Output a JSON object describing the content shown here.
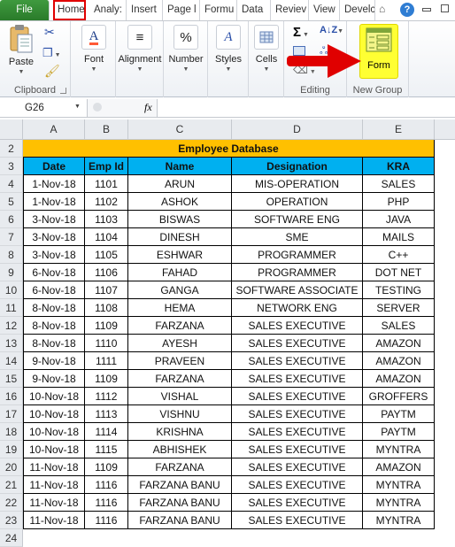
{
  "ribbon_tabs": [
    "File",
    "Home",
    "Analy:",
    "Insert",
    "Page l",
    "Formu",
    "Data",
    "Reviev",
    "View",
    "Develc"
  ],
  "active_tab": "Home",
  "window_controls": [
    "minimize-ribbon",
    "help",
    "minimize",
    "restore"
  ],
  "ribbon": {
    "clipboard": {
      "paste_label": "Paste",
      "group_label": "Clipboard"
    },
    "font_label": "Font",
    "alignment_label": "Alignment",
    "number_label": "Number",
    "number_icon": "%",
    "styles_label": "Styles",
    "cells_label": "Cells",
    "editing": {
      "group_label": "Editing",
      "sum_icon": "Σ"
    },
    "new_group": {
      "form_label": "Form",
      "group_label": "New Group"
    }
  },
  "formula_bar": {
    "name_box": "G26",
    "fx": "fx",
    "formula": ""
  },
  "columns": [
    "A",
    "B",
    "C",
    "D",
    "E"
  ],
  "sheet": {
    "title_row_number": "2",
    "title": "Employee Database",
    "header_row_number": "3",
    "headers": [
      "Date",
      "Emp Id",
      "Name",
      "Designation",
      "KRA"
    ],
    "rows": [
      {
        "n": "4",
        "cells": [
          "1-Nov-18",
          "1101",
          "ARUN",
          "MIS-OPERATION",
          "SALES"
        ]
      },
      {
        "n": "5",
        "cells": [
          "1-Nov-18",
          "1102",
          "ASHOK",
          "OPERATION",
          "PHP"
        ]
      },
      {
        "n": "6",
        "cells": [
          "3-Nov-18",
          "1103",
          "BISWAS",
          "SOFTWARE ENG",
          "JAVA"
        ]
      },
      {
        "n": "7",
        "cells": [
          "3-Nov-18",
          "1104",
          "DINESH",
          "SME",
          "MAILS"
        ]
      },
      {
        "n": "8",
        "cells": [
          "3-Nov-18",
          "1105",
          "ESHWAR",
          "PROGRAMMER",
          "C++"
        ]
      },
      {
        "n": "9",
        "cells": [
          "6-Nov-18",
          "1106",
          "FAHAD",
          "PROGRAMMER",
          "DOT NET"
        ]
      },
      {
        "n": "10",
        "cells": [
          "6-Nov-18",
          "1107",
          "GANGA",
          "SOFTWARE ASSOCIATE",
          "TESTING"
        ]
      },
      {
        "n": "11",
        "cells": [
          "8-Nov-18",
          "1108",
          "HEMA",
          "NETWORK ENG",
          "SERVER"
        ]
      },
      {
        "n": "12",
        "cells": [
          "8-Nov-18",
          "1109",
          "FARZANA",
          "SALES EXECUTIVE",
          "SALES"
        ]
      },
      {
        "n": "13",
        "cells": [
          "8-Nov-18",
          "1110",
          "AYESH",
          "SALES EXECUTIVE",
          "AMAZON"
        ]
      },
      {
        "n": "14",
        "cells": [
          "9-Nov-18",
          "1111",
          "PRAVEEN",
          "SALES EXECUTIVE",
          "AMAZON"
        ]
      },
      {
        "n": "15",
        "cells": [
          "9-Nov-18",
          "1109",
          "FARZANA",
          "SALES EXECUTIVE",
          "AMAZON"
        ]
      },
      {
        "n": "16",
        "cells": [
          "10-Nov-18",
          "1112",
          "VISHAL",
          "SALES EXECUTIVE",
          "GROFFERS"
        ]
      },
      {
        "n": "17",
        "cells": [
          "10-Nov-18",
          "1113",
          "VISHNU",
          "SALES EXECUTIVE",
          "PAYTM"
        ]
      },
      {
        "n": "18",
        "cells": [
          "10-Nov-18",
          "1114",
          "KRISHNA",
          "SALES EXECUTIVE",
          "PAYTM"
        ]
      },
      {
        "n": "19",
        "cells": [
          "10-Nov-18",
          "1115",
          "ABHISHEK",
          "SALES EXECUTIVE",
          "MYNTRA"
        ]
      },
      {
        "n": "20",
        "cells": [
          "11-Nov-18",
          "1109",
          "FARZANA",
          "SALES EXECUTIVE",
          "AMAZON"
        ]
      },
      {
        "n": "21",
        "cells": [
          "11-Nov-18",
          "1116",
          "FARZANA BANU",
          "SALES EXECUTIVE",
          "MYNTRA"
        ]
      },
      {
        "n": "22",
        "cells": [
          "11-Nov-18",
          "1116",
          "FARZANA BANU",
          "SALES EXECUTIVE",
          "MYNTRA"
        ]
      },
      {
        "n": "23",
        "cells": [
          "11-Nov-18",
          "1116",
          "FARZANA BANU",
          "SALES EXECUTIVE",
          "MYNTRA"
        ]
      }
    ],
    "empty_row_numbers": [
      "24"
    ]
  },
  "colors": {
    "title_fill": "#ffc000",
    "header_fill": "#00b0f0",
    "file_tab": "#2e7d32",
    "highlight_box": "#e00000",
    "form_highlight": "#ffff33",
    "arrow": "#e00000"
  }
}
